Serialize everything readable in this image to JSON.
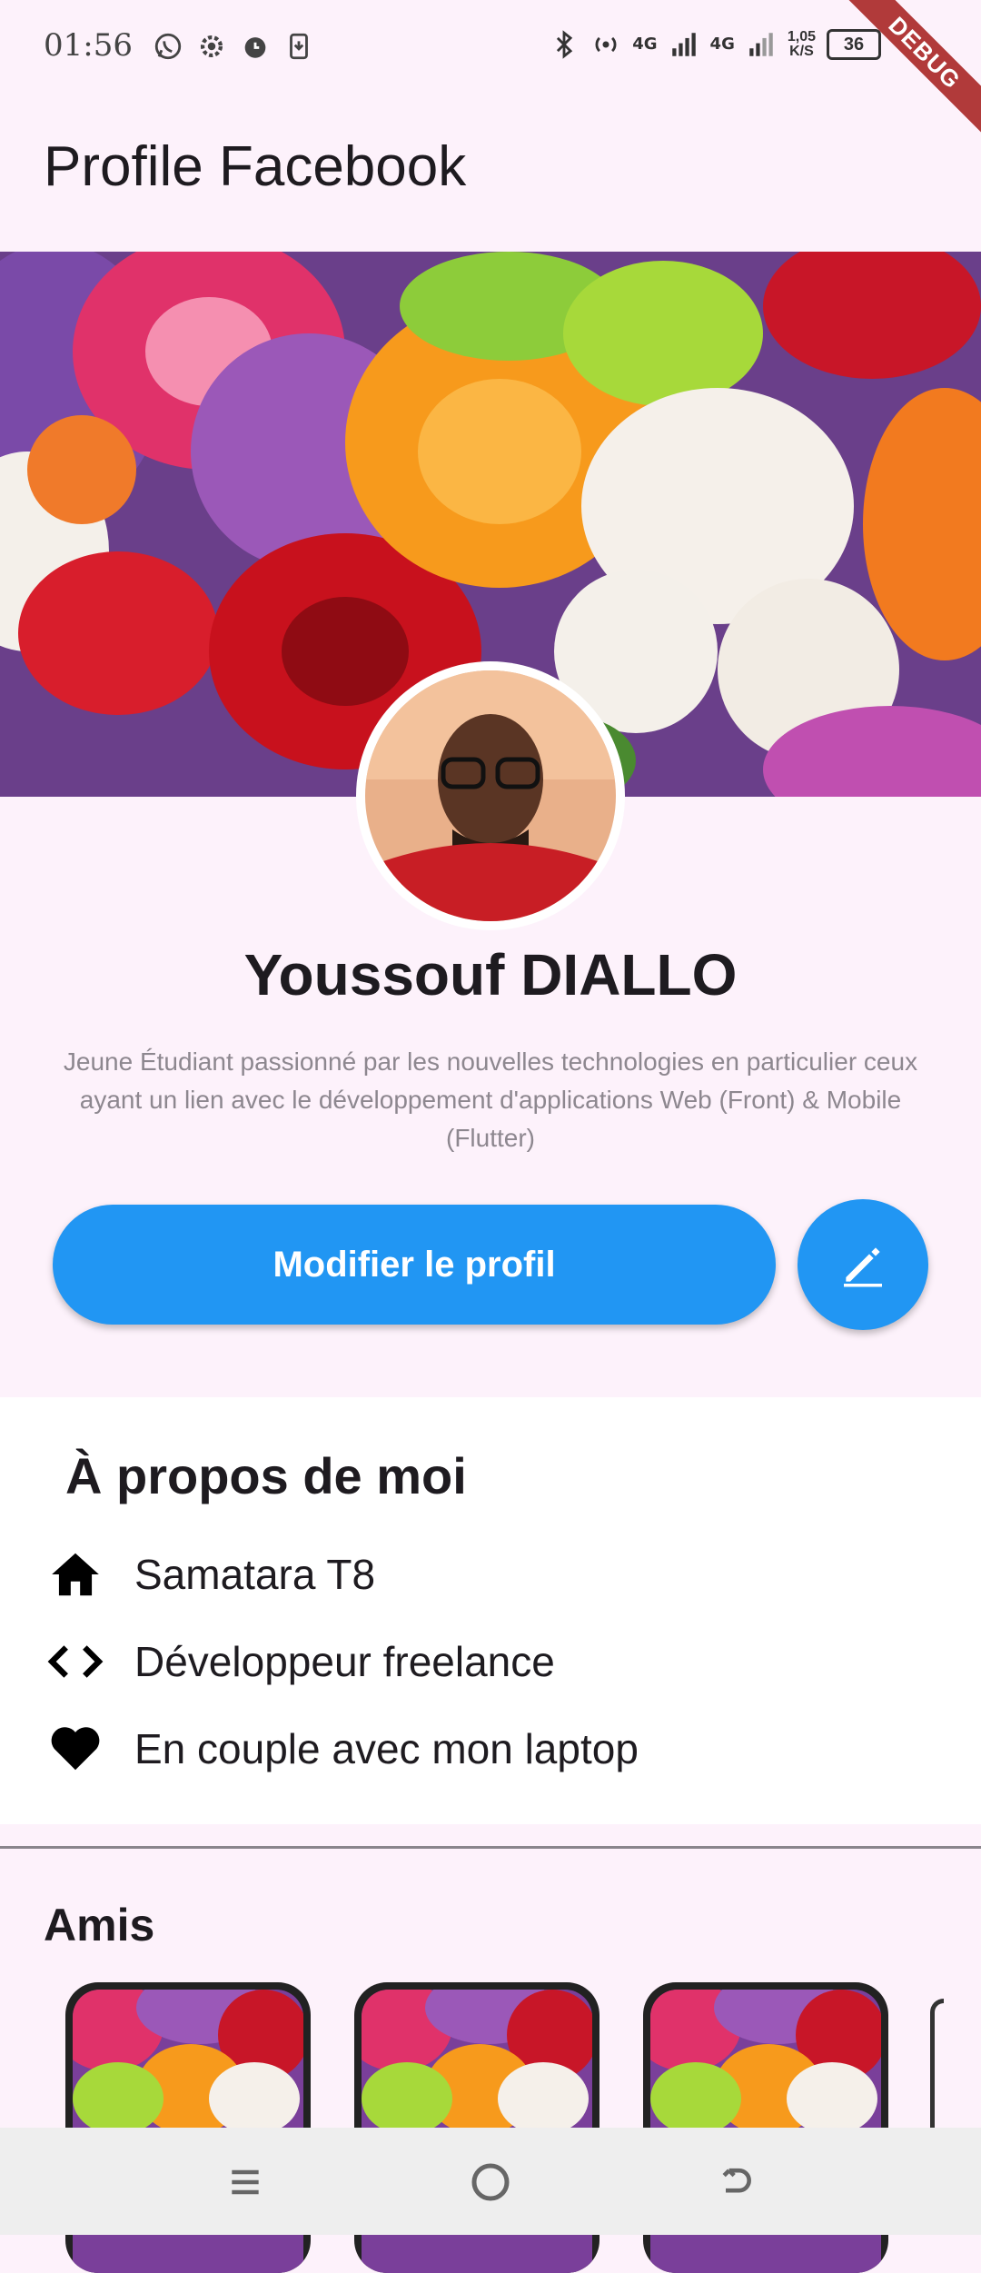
{
  "status_bar": {
    "time": "01:56",
    "left_icons": [
      "whatsapp-icon",
      "gear-icon",
      "alarm-icon",
      "download-icon"
    ],
    "network_1": "4G",
    "network_2": "4G",
    "speed_value": "1,05",
    "speed_unit": "K/S",
    "battery": "36",
    "debug_banner": "DEBUG"
  },
  "appbar": {
    "title": "Profile Facebook"
  },
  "profile": {
    "name": "Youssouf DIALLO",
    "bio": "Jeune Étudiant passionné par les nouvelles technologies en particulier ceux ayant un lien avec le développement d'applications Web (Front) & Mobile (Flutter)",
    "edit_button_label": "Modifier le profil",
    "fab_icon": "pencil-icon"
  },
  "about": {
    "title": "À propos de moi",
    "items": [
      {
        "icon": "home-icon",
        "label": "Samatara T8"
      },
      {
        "icon": "code-icon",
        "label": "Développeur freelance"
      },
      {
        "icon": "heart-icon",
        "label": "En couple avec mon laptop"
      }
    ]
  },
  "friends": {
    "title": "Amis"
  },
  "colors": {
    "primary": "#2196f3",
    "background": "#fdf2fb",
    "card": "#ffffff"
  },
  "navbar": {
    "icons": [
      "menu-icon",
      "home-circle-icon",
      "back-icon"
    ]
  }
}
